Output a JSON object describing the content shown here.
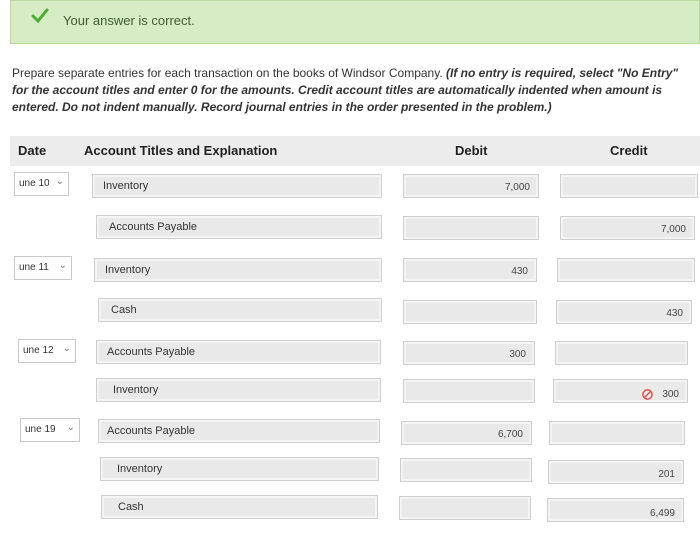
{
  "banner": {
    "message": "Your answer is correct."
  },
  "instructions": {
    "plain": "Prepare separate entries for each transaction on the books of Windsor Company. ",
    "bold": "(If no entry is required, select \"No Entry\" for the account titles and enter 0 for the amounts. Credit account titles are automatically indented when amount is entered. Do not indent manually. Record journal entries in the order presented in the problem.)"
  },
  "table": {
    "headers": {
      "date": "Date",
      "account": "Account Titles and Explanation",
      "debit": "Debit",
      "credit": "Credit"
    },
    "rows": [
      {
        "date": "une 10",
        "account": "Inventory",
        "debit": "7,000",
        "credit": ""
      },
      {
        "date": "",
        "account": "Accounts Payable",
        "debit": "",
        "credit": "7,000"
      },
      {
        "date": "une 11",
        "account": "Inventory",
        "debit": "430",
        "credit": ""
      },
      {
        "date": "",
        "account": "Cash",
        "debit": "",
        "credit": "430"
      },
      {
        "date": "une 12",
        "account": "Accounts Payable",
        "debit": "300",
        "credit": ""
      },
      {
        "date": "",
        "account": "Inventory",
        "debit": "",
        "credit": "300"
      },
      {
        "date": "une 19",
        "account": "Accounts Payable",
        "debit": "6,700",
        "credit": ""
      },
      {
        "date": "",
        "account": "Inventory",
        "debit": "",
        "credit": "201"
      },
      {
        "date": "",
        "account": "Cash",
        "debit": "",
        "credit": "6,499"
      }
    ]
  },
  "icons": {
    "correct": "check-icon",
    "dropdown": "chevron-down-icon",
    "warning": "no-entry-icon"
  },
  "colors": {
    "banner_bg": "#d6ecc5",
    "check": "#4caf2f",
    "warning": "#d9534f"
  }
}
